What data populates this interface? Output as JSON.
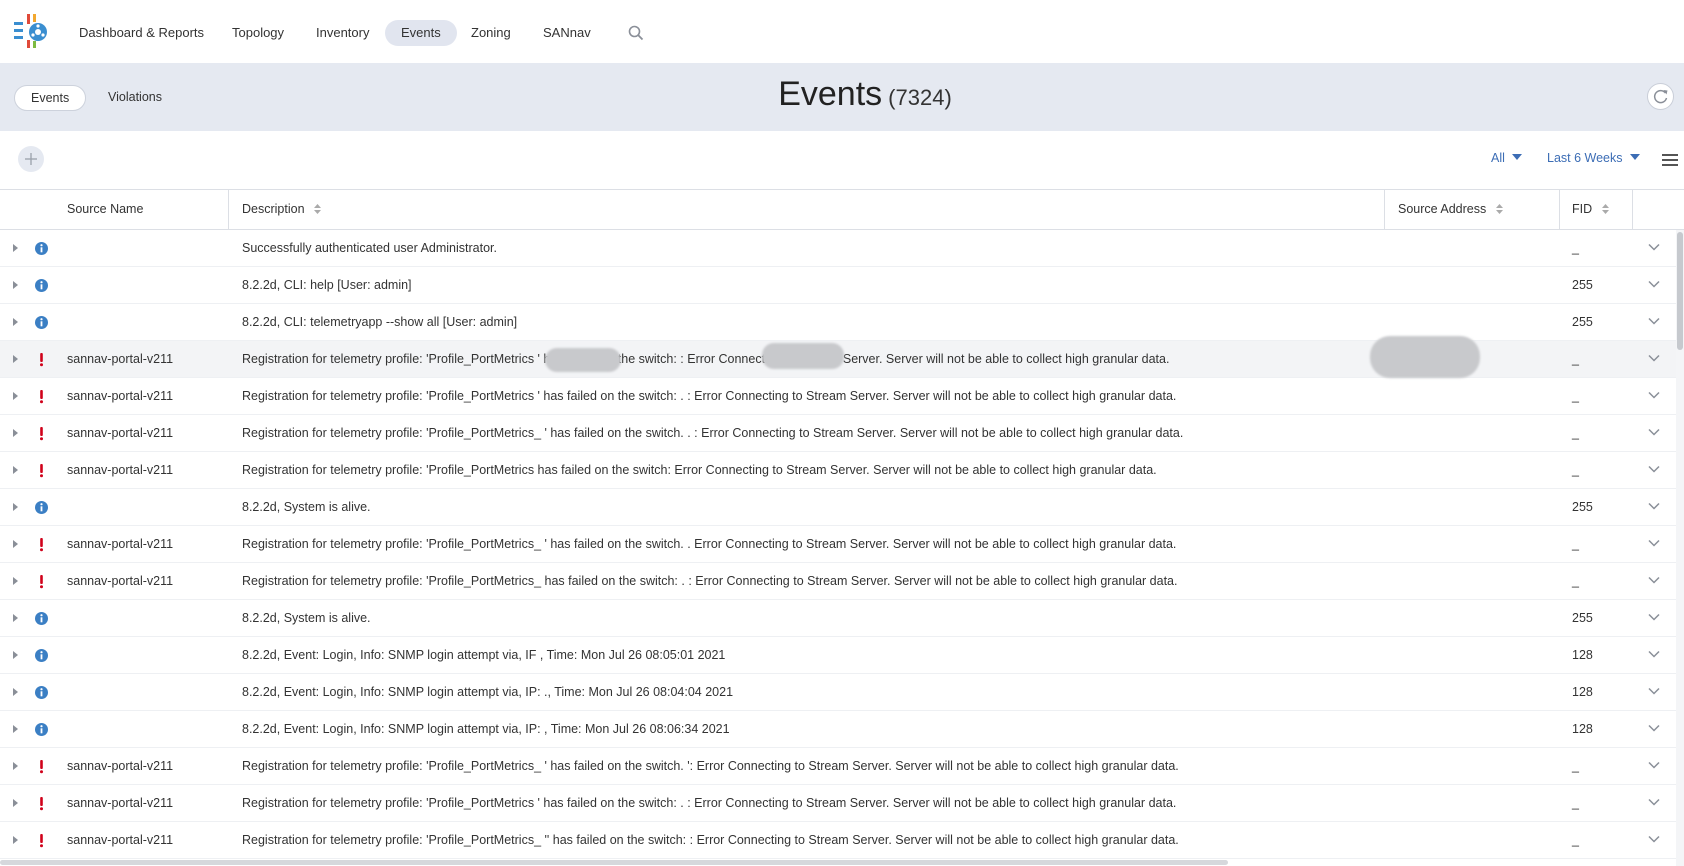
{
  "nav": {
    "items": [
      {
        "label": "Dashboard & Reports",
        "active": false
      },
      {
        "label": "Topology",
        "active": false
      },
      {
        "label": "Inventory",
        "active": false
      },
      {
        "label": "Events",
        "active": true
      },
      {
        "label": "Zoning",
        "active": false
      },
      {
        "label": "SANnav",
        "active": false
      }
    ],
    "search_icon": "search-icon"
  },
  "header": {
    "tabs": [
      {
        "label": "Events",
        "active": true
      },
      {
        "label": "Violations",
        "active": false
      }
    ],
    "title": "Events",
    "count": "(7324)",
    "refresh_icon": "refresh-icon"
  },
  "toolbar": {
    "severity_filter": "All",
    "time_filter": "Last 6 Weeks",
    "add_icon": "plus-icon",
    "menu_icon": "hamburger-menu-icon"
  },
  "table": {
    "columns": {
      "source_name": "Source Name",
      "description": "Description",
      "source_address": "Source Address",
      "fid": "FID"
    },
    "rows": [
      {
        "severity": "info",
        "source": "",
        "description": "Successfully authenticated user Administrator.",
        "fid": "_"
      },
      {
        "severity": "info",
        "source": "",
        "description": "8.2.2d, CLI: help [User: admin]",
        "fid": "255"
      },
      {
        "severity": "info",
        "source": "",
        "description": "8.2.2d, CLI: telemetryapp --show all [User: admin]",
        "fid": "255"
      },
      {
        "severity": "error",
        "source": "sannav-portal-v211",
        "description": "Registration for telemetry profile: 'Profile_PortMetrics               ' has failed on the switch:                 : Error Connecting to Stream Server. Server will not be able to collect high granular data.",
        "fid": "_"
      },
      {
        "severity": "error",
        "source": "sannav-portal-v211",
        "description": "Registration for telemetry profile: 'Profile_PortMetrics                ' has failed on the switch:                 . : Error Connecting to Stream Server. Server will not be able to collect high granular data.",
        "fid": "_"
      },
      {
        "severity": "error",
        "source": "sannav-portal-v211",
        "description": "Registration for telemetry profile: 'Profile_PortMetrics_               ' has failed on the switch.                 . : Error Connecting to Stream Server. Server will not be able to collect high granular data.",
        "fid": "_"
      },
      {
        "severity": "error",
        "source": "sannav-portal-v211",
        "description": "Registration for telemetry profile: 'Profile_PortMetrics                 has failed on the switch:                 Error Connecting to Stream Server. Server will not be able to collect high granular data.",
        "fid": "_"
      },
      {
        "severity": "info",
        "source": "",
        "description": "8.2.2d, System is alive.",
        "fid": "255"
      },
      {
        "severity": "error",
        "source": "sannav-portal-v211",
        "description": "Registration for telemetry profile: 'Profile_PortMetrics_               ' has failed on the switch.                 . Error Connecting to Stream Server. Server will not be able to collect high granular data.",
        "fid": "_"
      },
      {
        "severity": "error",
        "source": "sannav-portal-v211",
        "description": "Registration for telemetry profile: 'Profile_PortMetrics_                has failed on the switch:                 . : Error Connecting to Stream Server. Server will not be able to collect high granular data.",
        "fid": "_"
      },
      {
        "severity": "info",
        "source": "",
        "description": "8.2.2d, System is alive.",
        "fid": "255"
      },
      {
        "severity": "info",
        "source": "",
        "description": "8.2.2d, Event: Login, Info: SNMP login attempt via, IF                , Time: Mon Jul 26 08:05:01 2021",
        "fid": "128"
      },
      {
        "severity": "info",
        "source": "",
        "description": "8.2.2d, Event: Login, Info: SNMP login attempt via, IP:              ., Time: Mon Jul 26 08:04:04 2021",
        "fid": "128"
      },
      {
        "severity": "info",
        "source": "",
        "description": "8.2.2d, Event: Login, Info: SNMP login attempt via, IP:                , Time: Mon Jul 26 08:06:34 2021",
        "fid": "128"
      },
      {
        "severity": "error",
        "source": "sannav-portal-v211",
        "description": "Registration for telemetry profile: 'Profile_PortMetrics_               ' has failed on the switch.                 ': Error Connecting to Stream Server. Server will not be able to collect high granular data.",
        "fid": "_"
      },
      {
        "severity": "error",
        "source": "sannav-portal-v211",
        "description": "Registration for telemetry profile: 'Profile_PortMetrics                ' has failed on the switch:                 . : Error Connecting to Stream Server. Server will not be able to collect high granular data.",
        "fid": "_"
      },
      {
        "severity": "error",
        "source": "sannav-portal-v211",
        "description": "Registration for telemetry profile: 'Profile_PortMetrics_               '' has failed on the switch:                 : Error Connecting to Stream Server. Server will not be able to collect high granular data.",
        "fid": "_"
      }
    ]
  },
  "colors": {
    "header_bg": "#e5e9f1",
    "accent_blue": "#3c6db5",
    "info_icon": "#3b7fc4",
    "error_icon": "#d0021b"
  }
}
